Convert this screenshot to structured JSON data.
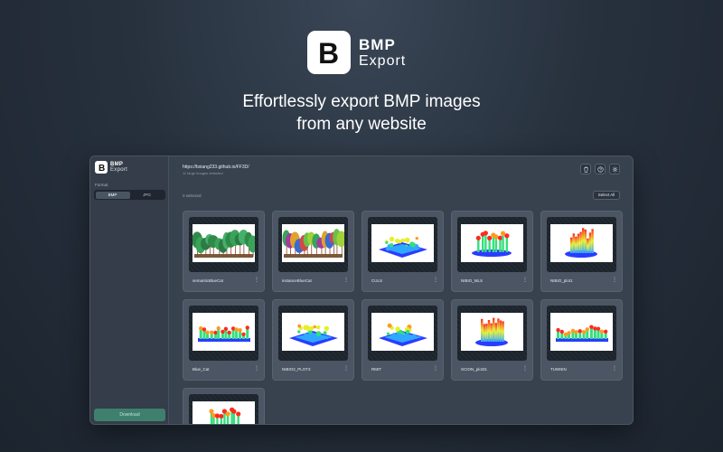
{
  "hero": {
    "logo_letter": "B",
    "logo_line1": "BMP",
    "logo_line2": "Export",
    "headline_line1": "Effortlessly export BMP images",
    "headline_line2": "from any website"
  },
  "app": {
    "sidebar": {
      "logo_line1": "BMP",
      "logo_line2": "Export",
      "format_label": "Format",
      "formats": [
        "BMP",
        "JPG"
      ],
      "selected_format": "BMP",
      "download_label": "Download"
    },
    "header": {
      "url": "https://bxiang233.github.io/FF3D/",
      "subtitle": "11 large images detected",
      "icons": [
        "trash-icon",
        "help-icon",
        "settings-icon"
      ]
    },
    "toolbar": {
      "selected_count": "0 selected",
      "select_all_label": "Select All"
    },
    "images": [
      {
        "name": "semanticBlueCat",
        "kind": "forest-semantic"
      },
      {
        "name": "instanceBlueCat",
        "kind": "forest-instance"
      },
      {
        "name": "CULS",
        "kind": "plot-flat"
      },
      {
        "name": "NIBIO_MLS",
        "kind": "plot-trees"
      },
      {
        "name": "NIBIO_plot1",
        "kind": "plot-tall"
      },
      {
        "name": "Blue_Cat",
        "kind": "strip"
      },
      {
        "name": "NIBIO2_PLOT3",
        "kind": "plot-flat"
      },
      {
        "name": "RMIT",
        "kind": "plot-flat"
      },
      {
        "name": "SCION_plot31",
        "kind": "plot-tall"
      },
      {
        "name": "TUWIEN",
        "kind": "strip"
      },
      {
        "name": "",
        "kind": "plot-trees"
      }
    ]
  },
  "colors": {
    "background": "#27313e",
    "panel": "#38424f",
    "card": "#4b5563",
    "download": "#3f7f6d"
  }
}
